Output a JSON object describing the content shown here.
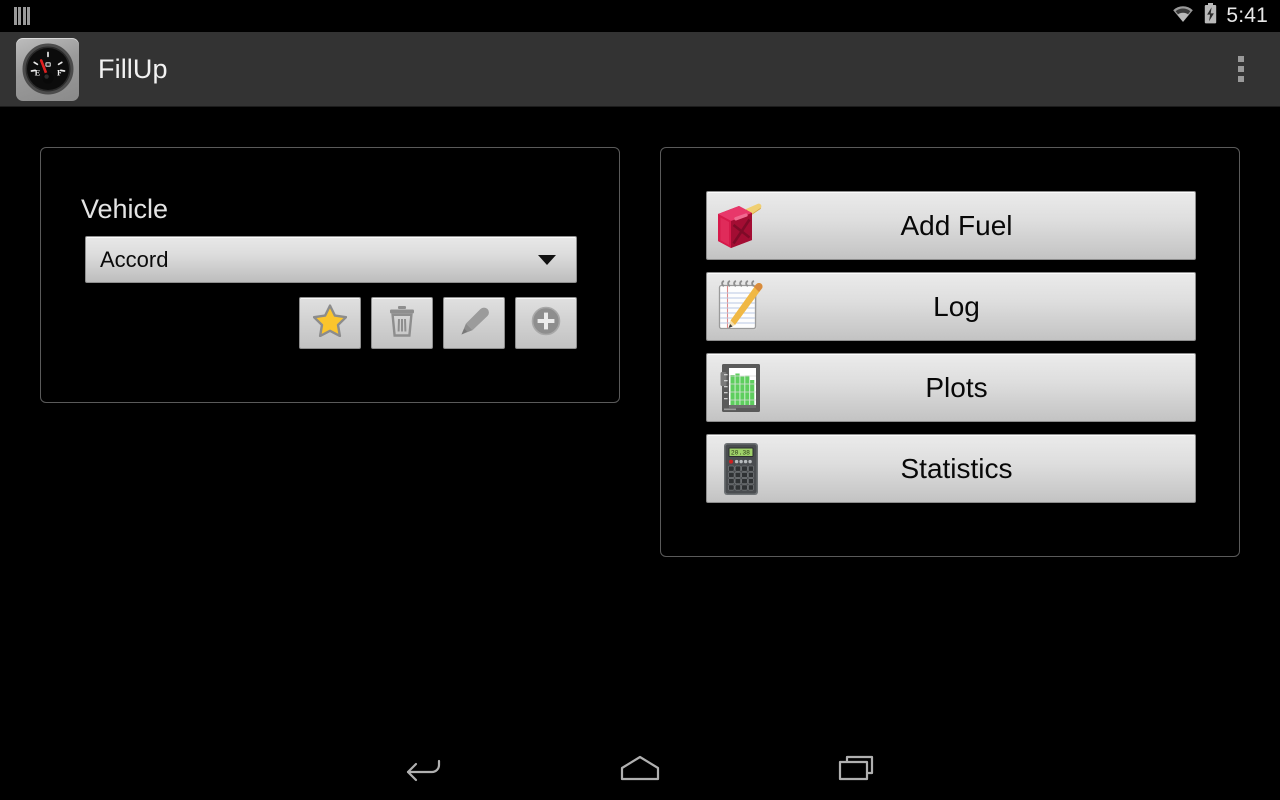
{
  "status_bar": {
    "sim_icon": "sim-bars-icon",
    "wifi_icon": "wifi-icon",
    "battery_icon": "battery-charging-icon",
    "time": "5:41"
  },
  "action_bar": {
    "app_icon": "fuel-gauge-app-icon",
    "title": "FillUp",
    "overflow_icon": "overflow-menu-icon"
  },
  "vehicle_panel": {
    "label": "Vehicle",
    "spinner": {
      "value": "Accord",
      "caret_icon": "chevron-down-icon"
    },
    "buttons": [
      {
        "name": "favorite-vehicle-button",
        "icon": "star-icon",
        "title": "Favorite"
      },
      {
        "name": "delete-vehicle-button",
        "icon": "trash-icon",
        "title": "Delete"
      },
      {
        "name": "edit-vehicle-button",
        "icon": "pencil-icon",
        "title": "Edit"
      },
      {
        "name": "add-vehicle-button",
        "icon": "plus-circle-icon",
        "title": "Add"
      }
    ]
  },
  "actions_panel": {
    "buttons": [
      {
        "name": "add-fuel-button",
        "label": "Add Fuel",
        "icon": "fuel-can-icon"
      },
      {
        "name": "log-button",
        "label": "Log",
        "icon": "notepad-pencil-icon"
      },
      {
        "name": "plots-button",
        "label": "Plots",
        "icon": "bar-chart-icon"
      },
      {
        "name": "statistics-button",
        "label": "Statistics",
        "icon": "calculator-icon"
      }
    ]
  },
  "nav_bar": {
    "back": "back-icon",
    "home": "home-icon",
    "recents": "recents-icon"
  },
  "colors": {
    "background": "#000000",
    "action_bar": "#333333",
    "panel_border": "#5a5a5a",
    "button_face": "#dedede",
    "star_gold": "#fbc52d",
    "fuel_can_red": "#d6194a",
    "chart_green": "#5ece5e"
  }
}
